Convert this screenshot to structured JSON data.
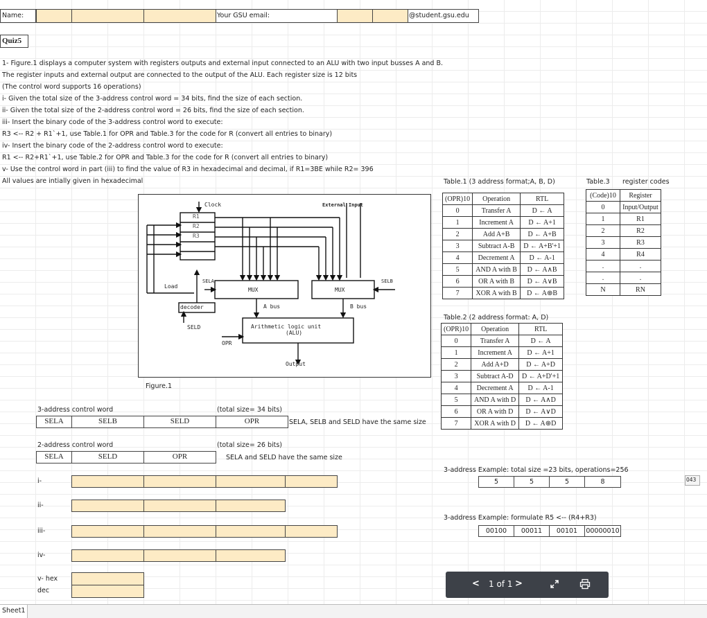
{
  "header": {
    "name_label": "Name:",
    "email_label": "Your GSU email:",
    "email_domain": "@student.gsu.edu"
  },
  "quiz_title": "Quiz5",
  "question": {
    "lines": [
      "1-  Figure.1 displays a computer system with registers outputs and external input connected to an ALU with two input busses A and B.",
      "     The register inputs and external output are connected to the output of the ALU. Each register size is 12 bits",
      "(The control word supports  16 operations)",
      "i-  Given the total size of the 3-address control word = 34 bits, find the size of each section.",
      "ii-  Given the total size of the 2-address control word = 26 bits, find the size of each section.",
      "iii-  Insert the binary code of the 3-address control word to execute:",
      "     R3 <-- R2 + R1`+1, use Table.1 for OPR and Table.3 for the code for R (convert all entries to binary)",
      "iv-  Insert the binary code of the 2-address control word to execute:",
      "     R1 <-- R2+R1`+1, use Table.2 for OPR and Table.3 for the code for R (convert all entries to binary)",
      "v-   Use the control word in part (iii) to find the value of R3 in hexadecimal and decimal, if R1=3BE while R2= 396",
      "All values are intially given in hexadecimal"
    ]
  },
  "figure": {
    "caption": "Figure.1",
    "clock": "Clock",
    "external_input": "External Input",
    "registers": [
      "R1",
      "R2",
      "R3"
    ],
    "load": "Load",
    "sela": "SELA",
    "selb": "SELB",
    "mux_a": "MUX",
    "mux_b": "MUX",
    "decoder": "decoder",
    "a_bus": "A bus",
    "b_bus": "B bus",
    "seld": "SELD",
    "alu_line1": "Arithmetic logic unit",
    "alu_line2": "(ALU)",
    "opr": "OPR",
    "output": "Output"
  },
  "table1": {
    "title": "Table.1 (3 address format;A, B, D)",
    "headers": [
      "(OPR)10",
      "Operation",
      "RTL"
    ],
    "rows": [
      [
        "0",
        "Transfer A",
        "D ← A"
      ],
      [
        "1",
        "Increment A",
        "D ← A+1"
      ],
      [
        "2",
        "Add A+B",
        "D ← A+B"
      ],
      [
        "3",
        "Subtract A-B",
        "D ← A+B'+1"
      ],
      [
        "4",
        "Decrement A",
        "D ← A-1"
      ],
      [
        "5",
        "AND A with B",
        "D ← A∧B"
      ],
      [
        "6",
        "OR A with B",
        "D ← A∨B"
      ],
      [
        "7",
        "XOR A with B",
        "D ← A⊕B"
      ]
    ]
  },
  "table2": {
    "title": "Table.2 (2 address format: A, D)",
    "headers": [
      "(OPR)10",
      "Operation",
      "RTL"
    ],
    "rows": [
      [
        "0",
        "Transfer A",
        "D ← A"
      ],
      [
        "1",
        "Increment A",
        "D ← A+1"
      ],
      [
        "2",
        "Add A+D",
        "D ← A+D"
      ],
      [
        "3",
        "Subtract A-D",
        "D ← A+D'+1"
      ],
      [
        "4",
        "Decrement A",
        "D ← A-1"
      ],
      [
        "5",
        "AND A with D",
        "D ← A∧D"
      ],
      [
        "6",
        "OR A with D",
        "D ← A∨D"
      ],
      [
        "7",
        "XOR A with D",
        "D ← A⊕D"
      ]
    ]
  },
  "table3": {
    "title": "Table.3",
    "title2": "register codes",
    "headers": [
      "(Code)10",
      "Register"
    ],
    "rows": [
      [
        "0",
        "Input/Output"
      ],
      [
        "1",
        "R1"
      ],
      [
        "2",
        "R2"
      ],
      [
        "3",
        "R3"
      ],
      [
        "4",
        "R4"
      ],
      [
        ".",
        "."
      ],
      [
        ".",
        "."
      ],
      [
        "N",
        "RN"
      ]
    ]
  },
  "cw3": {
    "label": "3-address control word",
    "total": "(total size= 34 bits)",
    "fields": [
      "SELA",
      "SELB",
      "SELD",
      "OPR"
    ],
    "note": "SELA, SELB and SELD have the same size"
  },
  "cw2": {
    "label": "2-address control word",
    "total": "(total size= 26 bits)",
    "fields": [
      "SELA",
      "SELD",
      "OPR"
    ],
    "note": "SELA and SELD have the same size"
  },
  "answers": {
    "i": "i-",
    "ii": "ii-",
    "iii": "iii-",
    "iv": "iv-",
    "v_hex": "v- hex",
    "v_dec": "dec"
  },
  "example1": {
    "title": "3-address Example: total size =23 bits, operations=256",
    "values": [
      "5",
      "5",
      "5",
      "8"
    ]
  },
  "example2": {
    "title": "3-address Example: formulate  R5 <-- (R4+R3)",
    "values": [
      "00100",
      "00011",
      "00101",
      "00000010"
    ]
  },
  "side_note": "043",
  "pager": {
    "prev": "<",
    "page": "1 of 1",
    "next": ">",
    "expand_icon": "expand-icon",
    "print_icon": "print-icon"
  },
  "sheet_tab": "Sheet1"
}
